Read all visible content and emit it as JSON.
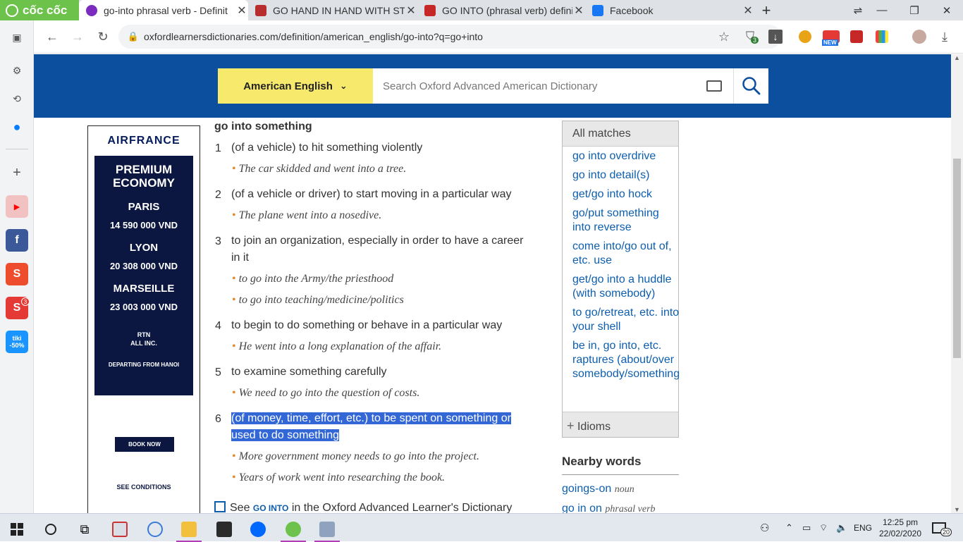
{
  "browser": {
    "brand": "cốc cốc",
    "tabs": [
      {
        "title": "go-into phrasal verb - Definit",
        "color": "#7b2cbf",
        "active": true
      },
      {
        "title": "GO HAND IN HAND WITH ST",
        "color": "#b82e2e",
        "active": false
      },
      {
        "title": "GO INTO (phrasal verb) defini",
        "color": "#c62828",
        "active": false
      },
      {
        "title": "Facebook",
        "color": "#1877f2",
        "active": false
      }
    ],
    "url": "oxfordlearnersdictionaries.com/definition/american_english/go-into?q=go+into",
    "shield_badge": "3",
    "new_badge": "NEW"
  },
  "sidebar": {
    "apps": [
      {
        "name": "youtube",
        "label": "▶",
        "color": "#ff0000"
      },
      {
        "name": "facebook",
        "label": "f",
        "color": "#3b5998"
      },
      {
        "name": "shopee",
        "label": "S",
        "color": "#ee4d2d"
      },
      {
        "name": "sendo",
        "label": "S",
        "color": "#e53935"
      },
      {
        "name": "tiki",
        "label": "tiki -50%",
        "color": "#1a94ff"
      }
    ],
    "sendo_badge": "3"
  },
  "dictionary": {
    "language": "American English",
    "search_placeholder": "Search Oxford Advanced American Dictionary",
    "sense_heading": "go into something",
    "senses": [
      {
        "num": "1",
        "def": "(of a vehicle) to hit something violently",
        "examples": [
          "The car skidded and went into a tree."
        ]
      },
      {
        "num": "2",
        "def": "(of a vehicle or driver) to start moving in a particular way",
        "examples": [
          "The plane went into a nosedive."
        ]
      },
      {
        "num": "3",
        "def": "to join an organization, especially in order to have a career in it",
        "examples": [
          "to go into the Army/the priesthood",
          "to go into teaching/medicine/politics"
        ]
      },
      {
        "num": "4",
        "def": "to begin to do something or behave in a particular way",
        "examples": [
          "He went into a long explanation of the affair."
        ]
      },
      {
        "num": "5",
        "def": "to examine something carefully",
        "examples": [
          "We need to go into the question of costs."
        ]
      },
      {
        "num": "6",
        "def": "(of money, time, effort, etc.) to be spent on something or used to do something",
        "examples": [
          "More government money needs to go into the project.",
          "Years of work went into researching the book."
        ]
      }
    ],
    "see_prefix": "See",
    "see_link": "go into",
    "see_suffix": "in the Oxford Advanced Learner's Dictionary"
  },
  "ad": {
    "brand": "AIRFRANCE",
    "headline": "PREMIUM ECONOMY",
    "fares": [
      {
        "city": "PARIS",
        "price": "14 590 000 VND"
      },
      {
        "city": "LYON",
        "price": "20 308 000 VND"
      },
      {
        "city": "MARSEILLE",
        "price": "23 003 000 VND"
      }
    ],
    "rtn": "RTN",
    "all_inc": "ALL INC.",
    "departing": "DEPARTING FROM HANOI",
    "book": "BOOK NOW",
    "conditions": "SEE CONDITIONS"
  },
  "matches": {
    "header": "All matches",
    "items": [
      "go into overdrive",
      "go into detail(s)",
      "get/go into hock",
      "go/put something into reverse",
      "come into/go out of, etc. use",
      "get/go into a huddle (with somebody)",
      "to go/retreat, etc. into your shell",
      "be in, go into, etc. raptures (about/over somebody/something)"
    ],
    "idioms": "Idioms"
  },
  "nearby": {
    "title": "Nearby words",
    "items": [
      {
        "word": "goings-on",
        "pos": "noun"
      },
      {
        "word": "go in on",
        "pos": "phrasal verb"
      }
    ]
  },
  "taskbar": {
    "lang": "ENG",
    "time": "12:25 pm",
    "date": "22/02/2020",
    "notif_count": "20"
  }
}
